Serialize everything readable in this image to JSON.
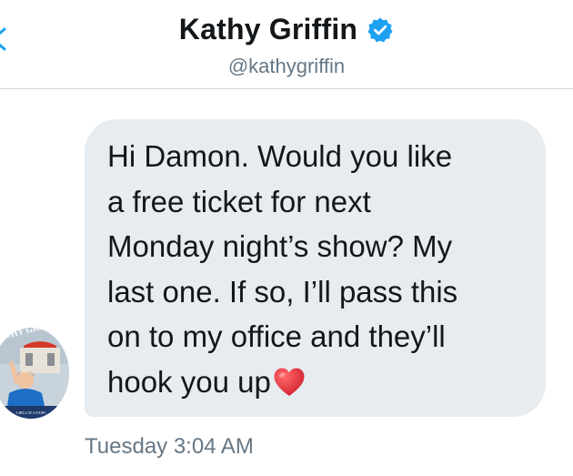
{
  "header": {
    "name": "Kathy Griffin",
    "handle": "@kathygriffin"
  },
  "avatar": {
    "banner_text": "THY GRIF",
    "caption": "A HELL OF A STORY"
  },
  "message": {
    "lines": [
      "Hi Damon. Would you like",
      "a free ticket for next",
      "Monday night’s show? My",
      "last one. If so, I’ll pass this",
      "on to my office and they’ll",
      "hook you up"
    ],
    "emoji": "heart-emoji"
  },
  "timestamp": "Tuesday 3:04 AM",
  "colors": {
    "accent": "#1da1f2",
    "bubble": "#e6ecf0",
    "secondary_text": "#657786",
    "heart": "#e0243b"
  }
}
